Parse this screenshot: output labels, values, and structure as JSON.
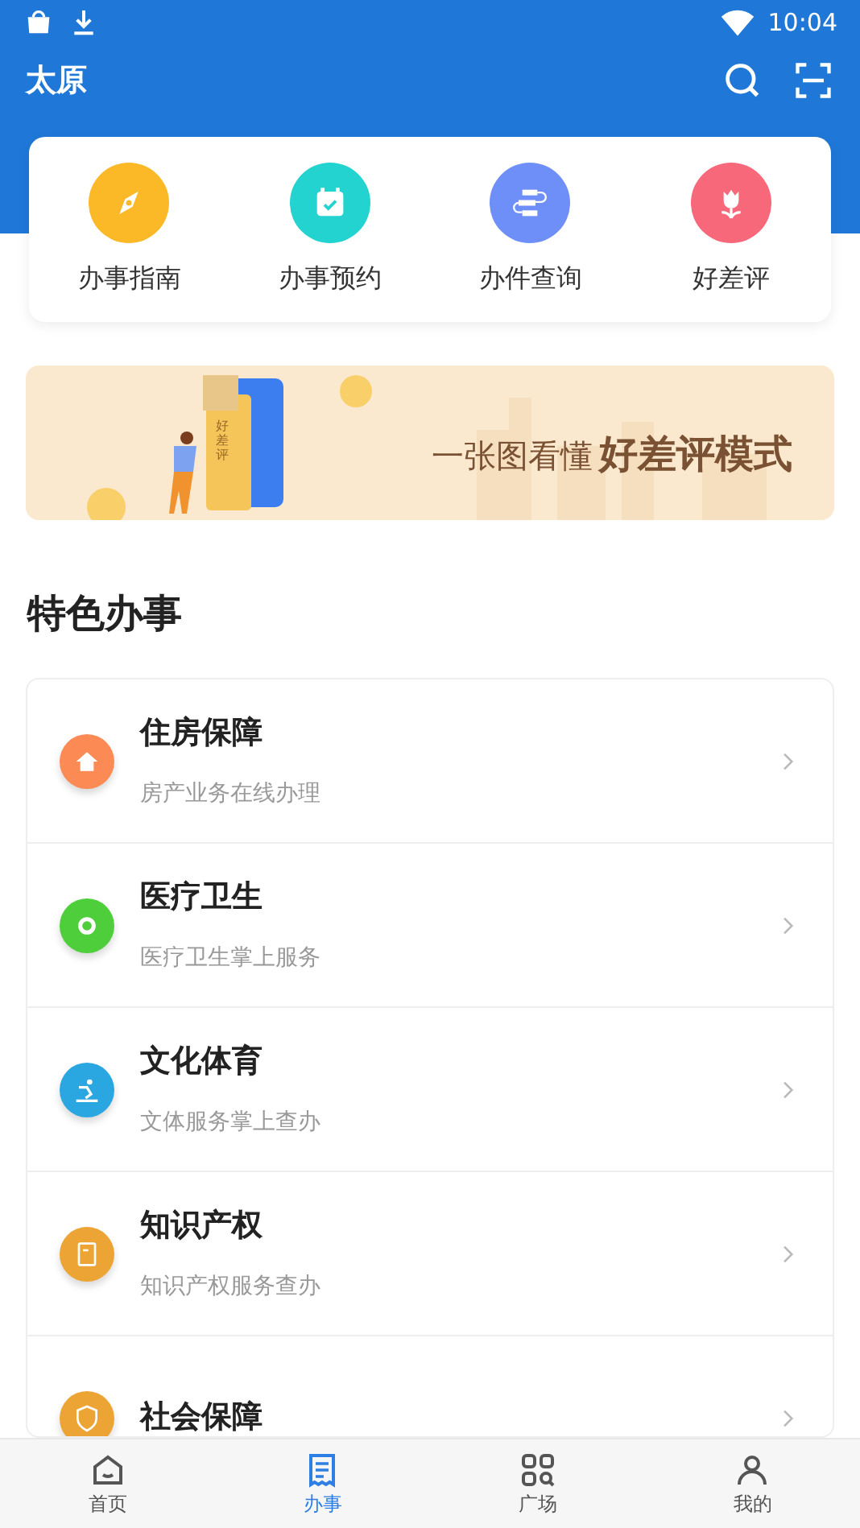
{
  "status_bar": {
    "time": "10:04"
  },
  "header": {
    "title": "太原"
  },
  "quick_actions": [
    {
      "label": "办事指南",
      "color": "#fbb928",
      "kind": "compass"
    },
    {
      "label": "办事预约",
      "color": "#22d3cf",
      "kind": "calendar"
    },
    {
      "label": "办件查询",
      "color": "#6f8ff8",
      "kind": "flow"
    },
    {
      "label": "好差评",
      "color": "#f6687a",
      "kind": "flower"
    }
  ],
  "banner": {
    "lead": "一张图看懂",
    "emphasis": "好差评模式",
    "tag": "好差评"
  },
  "section_title": "特色办事",
  "services": [
    {
      "title": "住房保障",
      "subtitle": "房产业务在线办理",
      "color": "#fb8a55",
      "kind": "house"
    },
    {
      "title": "医疗卫生",
      "subtitle": "医疗卫生掌上服务",
      "color": "#4fce3c",
      "kind": "medical"
    },
    {
      "title": "文化体育",
      "subtitle": "文体服务掌上查办",
      "color": "#2aa6e0",
      "kind": "sport"
    },
    {
      "title": "知识产权",
      "subtitle": "知识产权服务查办",
      "color": "#eca434",
      "kind": "doc"
    },
    {
      "title": "社会保障",
      "color": "#eca434",
      "kind": "shield"
    }
  ],
  "bottom_nav": [
    {
      "label": "首页",
      "selected": false,
      "kind": "home"
    },
    {
      "label": "办事",
      "selected": true,
      "kind": "receipt"
    },
    {
      "label": "广场",
      "selected": false,
      "kind": "grid"
    },
    {
      "label": "我的",
      "selected": false,
      "kind": "person"
    }
  ]
}
